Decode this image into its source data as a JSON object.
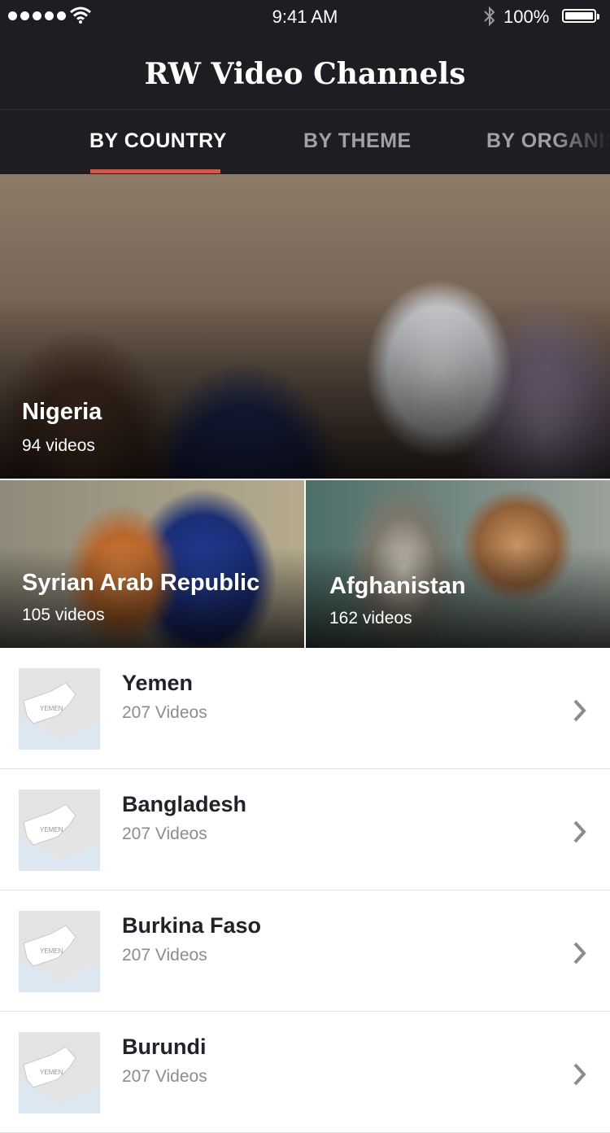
{
  "status_bar": {
    "time": "9:41 AM",
    "battery": "100%",
    "signal_icon": "signal-dots-icon",
    "wifi_icon": "wifi-icon",
    "bluetooth_icon": "bluetooth-icon"
  },
  "header": {
    "title": "RW Video Channels"
  },
  "tabs": [
    {
      "label": "BY COUNTRY",
      "active": true
    },
    {
      "label": "BY THEME",
      "active": false
    },
    {
      "label": "BY ORGANISA",
      "active": false
    }
  ],
  "featured": {
    "hero": {
      "title": "Nigeria",
      "count": "94 videos"
    },
    "tiles": [
      {
        "title": "Syrian Arab Republic",
        "count": "105 videos"
      },
      {
        "title": "Afghanistan",
        "count": "162 videos"
      }
    ]
  },
  "list": {
    "items": [
      {
        "name": "Yemen",
        "count": "207 Videos",
        "map_label": "YEMEN"
      },
      {
        "name": "Bangladesh",
        "count": "207 Videos",
        "map_label": "YEMEN"
      },
      {
        "name": "Burkina Faso",
        "count": "207 Videos",
        "map_label": "YEMEN"
      },
      {
        "name": "Burundi",
        "count": "207 Videos",
        "map_label": "YEMEN"
      }
    ]
  },
  "colors": {
    "nav_background": "#1f1c22",
    "tab_active": "#ffffff",
    "tab_inactive": "#a39fa8",
    "tab_indicator": "#e2533f",
    "secondary_text": "#8c8c8c"
  }
}
